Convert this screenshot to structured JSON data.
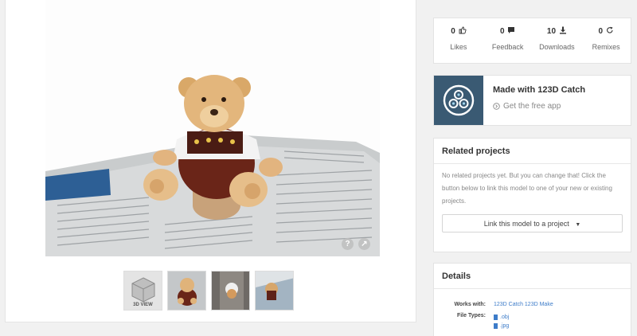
{
  "stats": [
    {
      "value": "0",
      "icon": "thumbs-up-icon",
      "label": "Likes"
    },
    {
      "value": "0",
      "icon": "comment-icon",
      "label": "Feedback"
    },
    {
      "value": "10",
      "icon": "download-icon",
      "label": "Downloads"
    },
    {
      "value": "0",
      "icon": "remix-icon",
      "label": "Remixes"
    }
  ],
  "promo": {
    "title": "Made with 123D Catch",
    "link": "Get the free app"
  },
  "related": {
    "header": "Related projects",
    "text": "No related projects yet. But you can change that! Click the button below to link this model to one of your new or existing projects.",
    "button": "Link this model to a project"
  },
  "details": {
    "header": "Details",
    "works_with_label": "Works with:",
    "works_with_value": "123D Catch 123D Make",
    "file_types_label": "File Types:",
    "file_types": [
      ".obj",
      ".jpg"
    ]
  },
  "viewer": {
    "thumb_3d_label": "3D VIEW",
    "help_glyph": "?",
    "share_glyph": "↗"
  },
  "colors": {
    "accent": "#3d7cc9",
    "catch_logo": "#3a5a73"
  }
}
